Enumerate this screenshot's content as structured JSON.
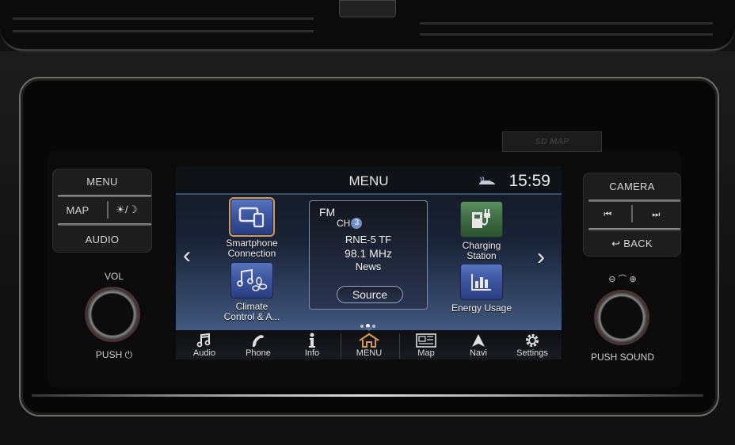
{
  "hardware": {
    "sd_slot_label": "SD MAP",
    "left_buttons": {
      "menu": "MENU",
      "map": "MAP",
      "day_night": "☀/☽",
      "audio": "AUDIO"
    },
    "right_buttons": {
      "camera": "CAMERA",
      "prev": "⏮",
      "next": "⏭",
      "back": "BACK",
      "back_icon": "↩"
    },
    "vol_label": "VOL",
    "push_power_label": "PUSH ⏻",
    "tune_zoom_label": "⊖ ⌒ ⊕",
    "push_sound_label": "PUSH SOUND"
  },
  "screen": {
    "title": "MENU",
    "clock": "15:59",
    "status_icon": "car-connected-icon",
    "tiles": [
      {
        "label_line1": "Smartphone",
        "label_line2": "Connection",
        "icon": "smartphone-connection-icon",
        "selected": true
      },
      {
        "label_line1": "Climate",
        "label_line2": "Control & A...",
        "icon": "climate-audio-icon"
      },
      {
        "label_line1": "Charging",
        "label_line2": "Station",
        "icon": "charging-station-icon"
      },
      {
        "label_line1": "Energy Usage",
        "label_line2": "",
        "icon": "energy-usage-icon"
      }
    ],
    "radio": {
      "band": "FM",
      "channel_prefix": "CH",
      "channel_number": "3",
      "station": "RNE-5 TF",
      "frequency": "98.1 MHz",
      "program_type": "News",
      "source_button": "Source"
    },
    "page_indicator": {
      "pages": 3,
      "current": 2
    },
    "nav_prev": "‹",
    "nav_next": "›",
    "bottom_nav": [
      {
        "label": "Audio",
        "icon": "music-note-icon"
      },
      {
        "label": "Phone",
        "icon": "phone-icon"
      },
      {
        "label": "Info",
        "icon": "info-icon"
      },
      {
        "label": "MENU",
        "icon": "home-icon",
        "active": true
      },
      {
        "label": "Map",
        "icon": "map-icon"
      },
      {
        "label": "Navi",
        "icon": "navigation-arrow-icon"
      },
      {
        "label": "Settings",
        "icon": "gear-icon"
      }
    ],
    "colors": {
      "active_accent": "#d39a5a",
      "tile_blue": "#3c56a0",
      "tile_green": "#3f6e45"
    }
  }
}
